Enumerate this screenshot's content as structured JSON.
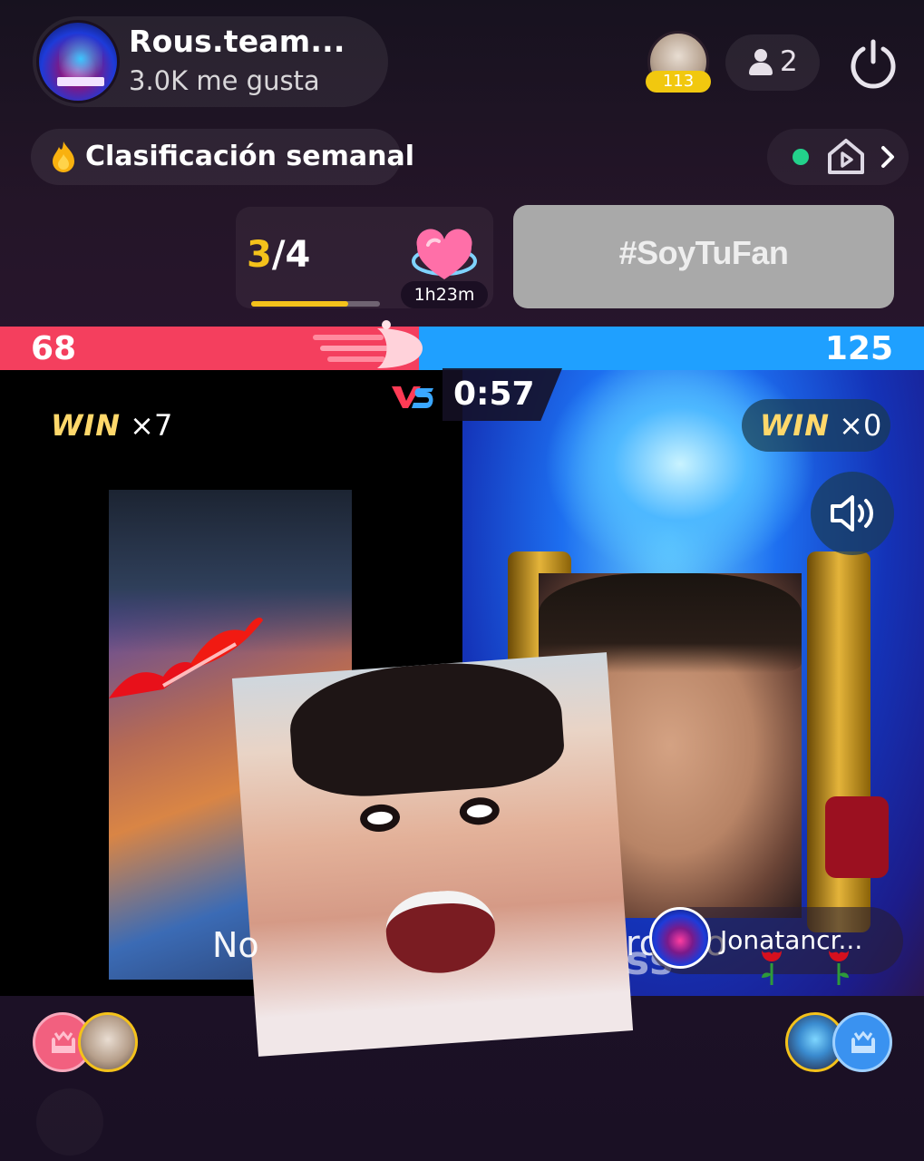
{
  "host": {
    "name": "Rous.team...",
    "likes": "3.0K me gusta"
  },
  "top_viewer": {
    "badge": "113"
  },
  "viewers": {
    "count": "2"
  },
  "ranking": {
    "label": "Clasificación semanal"
  },
  "round": {
    "current": "3",
    "separator": "/",
    "total": "4",
    "progress_fraction": 0.75,
    "timer": "1h23m"
  },
  "hashtag": "#SoyTuFan",
  "battle": {
    "score_left": "68",
    "score_right": "125",
    "vs": "VS",
    "time_left": "0:57",
    "win_left_word": "WIN",
    "win_left_count": "×7",
    "win_right_word": "WIN",
    "win_right_count": "×0",
    "left_caption": "No",
    "right_caption": "rostro",
    "right_watermark": "ss",
    "opponent_name": "Jonatancr..."
  },
  "colors": {
    "red_team": "#f43f5e",
    "blue_team": "#1fa0ff",
    "accent_gold": "#f4c21b",
    "win_gold": "#ffd86b"
  },
  "icons": {
    "power": "power-icon",
    "person": "person-icon",
    "flame": "flame-icon",
    "home_play": "home-play-icon",
    "chevron": "chevron-right-icon",
    "speaker": "speaker-icon",
    "seat": "sofa-icon",
    "rose": "rose-icon",
    "heart": "heart-icon"
  }
}
